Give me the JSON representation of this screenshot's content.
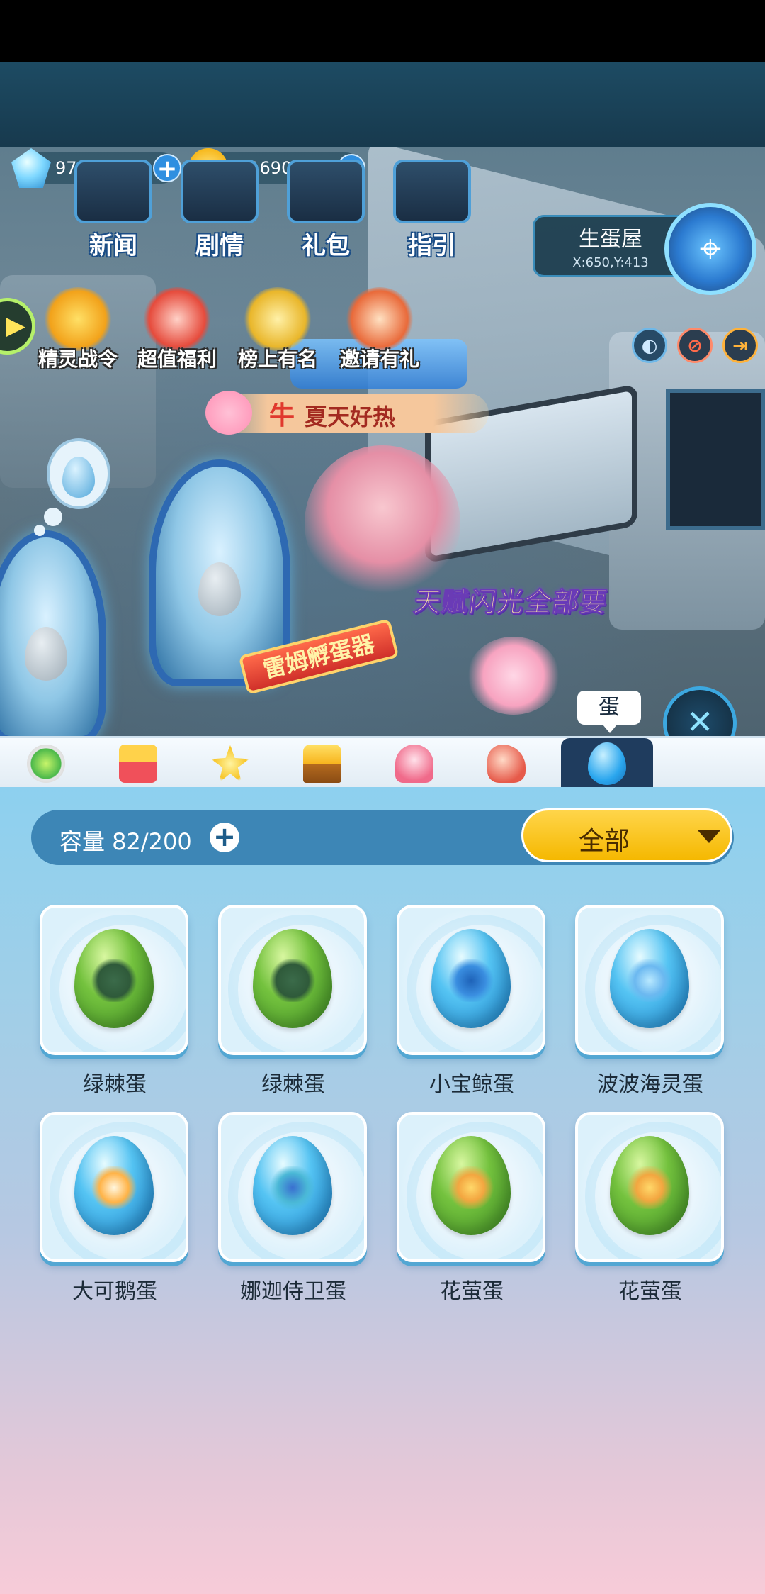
{
  "resources": {
    "diamonds": "97",
    "coins": "11690"
  },
  "top_menu": [
    {
      "label": "新闻",
      "icon": "news-screen-icon"
    },
    {
      "label": "剧情",
      "icon": "story-device-icon"
    },
    {
      "label": "礼包",
      "icon": "gift-pack-icon"
    },
    {
      "label": "指引",
      "icon": "guide-device-icon"
    }
  ],
  "location": {
    "title": "生蛋屋",
    "coords": "X:650,Y:413",
    "map_icon": "map-pin-icon"
  },
  "activities": [
    {
      "label": "精灵战令",
      "icon": "battle-pass-icon"
    },
    {
      "label": "超值福利",
      "icon": "gift-box-icon"
    },
    {
      "label": "榜上有名",
      "icon": "trophy-icon"
    },
    {
      "label": "邀请有礼",
      "icon": "invite-letter-icon"
    }
  ],
  "player": {
    "level_badge": "牛",
    "name": "夏天好热"
  },
  "scene": {
    "talent_banner": "天赋闪光全部要",
    "incubator_sign": "雷姆孵蛋器"
  },
  "tabs": [
    {
      "name": "battery-tab-icon"
    },
    {
      "name": "blocks-tab-icon"
    },
    {
      "name": "star-wand-tab-icon"
    },
    {
      "name": "star-trophy-tab-icon"
    },
    {
      "name": "dress-tab-icon"
    },
    {
      "name": "rocking-horse-tab-icon"
    },
    {
      "name": "egg-tab-icon"
    }
  ],
  "active_tab_tooltip": "蛋",
  "capacity": {
    "label": "容量 82/200"
  },
  "filter": {
    "selected": "全部"
  },
  "eggs": [
    {
      "name": "绿棘蛋",
      "color": "green",
      "deco": "dragon"
    },
    {
      "name": "绿棘蛋",
      "color": "green",
      "deco": "dragon"
    },
    {
      "name": "小宝鲸蛋",
      "color": "blue",
      "deco": "whale"
    },
    {
      "name": "波波海灵蛋",
      "color": "blue",
      "deco": "sea"
    },
    {
      "name": "大可鹅蛋",
      "color": "blue",
      "deco": "duck"
    },
    {
      "name": "娜迦侍卫蛋",
      "color": "blue",
      "deco": "naga"
    },
    {
      "name": "花萤蛋",
      "color": "green",
      "deco": "flower"
    },
    {
      "name": "花萤蛋",
      "color": "green",
      "deco": "flower"
    }
  ],
  "colors": {
    "panel_top": "#8dd0ef",
    "panel_bottom": "#f7cbd8",
    "capacity_bar": "#3d86b6",
    "filter_button": "#f5b800",
    "active_tab": "#1f3c5e"
  }
}
